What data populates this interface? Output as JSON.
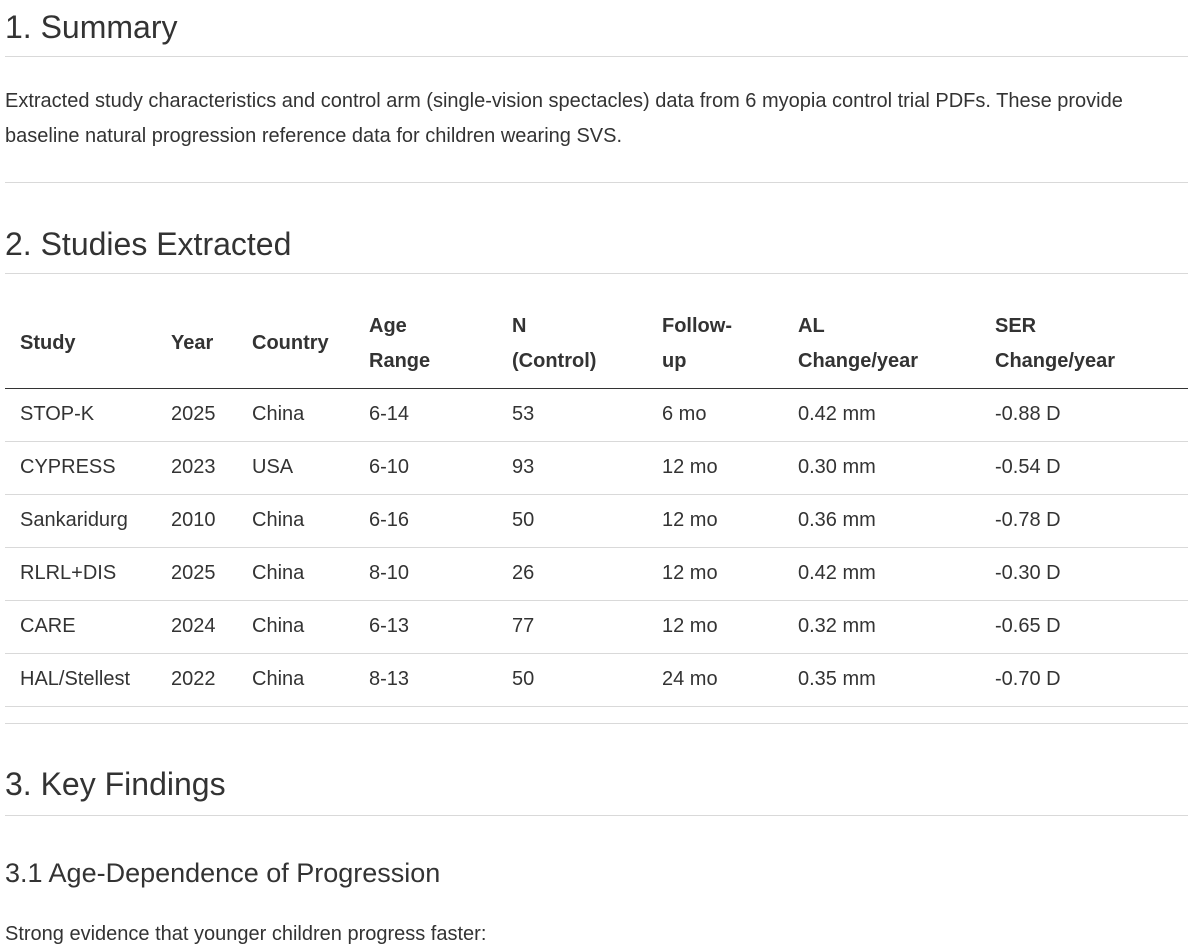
{
  "summary": {
    "heading": "1. Summary",
    "body": "Extracted study characteristics and control arm (single-vision spectacles) data from 6 myopia control trial PDFs. These provide baseline natural progression reference data for children wearing SVS."
  },
  "studies": {
    "heading": "2. Studies Extracted",
    "columns": [
      [
        "Study"
      ],
      [
        "Year"
      ],
      [
        "Country"
      ],
      [
        "Age",
        "Range"
      ],
      [
        "N",
        "(Control)"
      ],
      [
        "Follow-",
        "up"
      ],
      [
        "AL",
        "Change/year"
      ],
      [
        "SER",
        "Change/year"
      ]
    ],
    "rows": [
      [
        "STOP-K",
        "2025",
        "China",
        "6-14",
        "53",
        "6 mo",
        "0.42 mm",
        "-0.88 D"
      ],
      [
        "CYPRESS",
        "2023",
        "USA",
        "6-10",
        "93",
        "12 mo",
        "0.30 mm",
        "-0.54 D"
      ],
      [
        "Sankaridurg",
        "2010",
        "China",
        "6-16",
        "50",
        "12 mo",
        "0.36 mm",
        "-0.78 D"
      ],
      [
        "RLRL+DIS",
        "2025",
        "China",
        "8-10",
        "26",
        "12 mo",
        "0.42 mm",
        "-0.30 D"
      ],
      [
        "CARE",
        "2024",
        "China",
        "6-13",
        "77",
        "12 mo",
        "0.32 mm",
        "-0.65 D"
      ],
      [
        "HAL/Stellest",
        "2022",
        "China",
        "8-13",
        "50",
        "24 mo",
        "0.35 mm",
        "-0.70 D"
      ]
    ]
  },
  "findings": {
    "heading": "3. Key Findings",
    "subheading": "3.1 Age-Dependence of Progression",
    "intro": "Strong evidence that younger children progress faster:"
  }
}
